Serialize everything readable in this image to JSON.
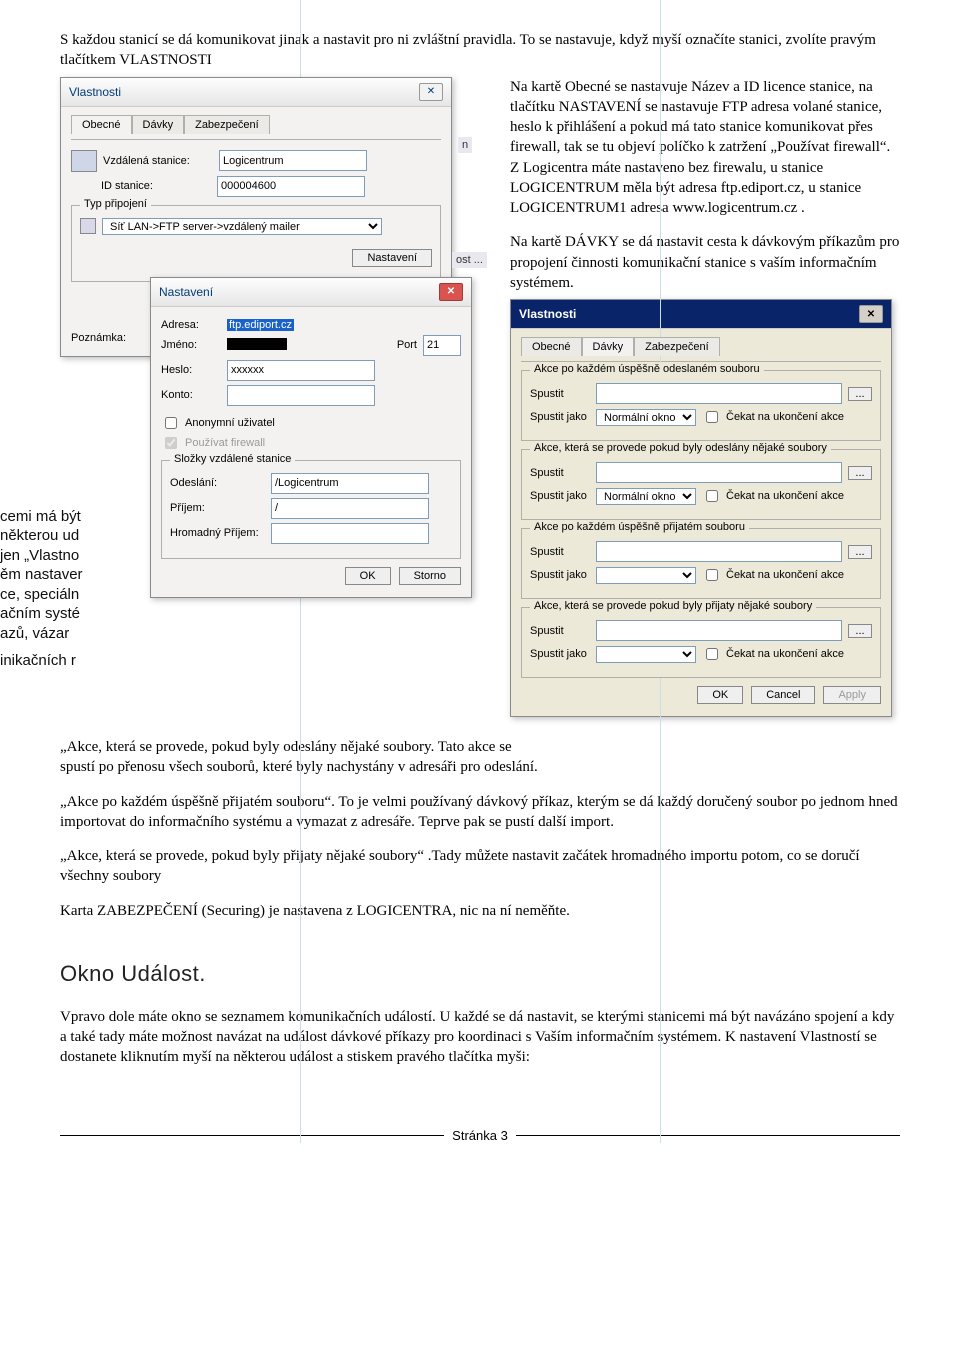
{
  "intro": "S každou stanicí se dá komunikovat jinak a nastavit pro ni zvláštní pravidla. To se nastavuje, když myší označíte stanici, zvolíte pravým tlačítkem VLASTNOSTI",
  "right1": "Na kartě Obecné se nastavuje Název a ID licence stanice, na tlačítku NASTAVENÍ se nastavuje FTP adresa volané stanice, heslo k přihlášení a pokud má tato stanice komunikovat přes firewall, tak se tu objeví políčko k zatržení „Používat firewall“. Z Logicentra máte nastaveno bez firewalu, u stanice LOGICENTRUM měla být adresa ftp.ediport.cz, u stanice LOGICENTRUM1 adresa www.logicentrum.cz .",
  "right2": "Na kartě DÁVKY se dá nastavit cesta k dávkovým příkazům pro propojení činnosti komunikační stanice s vaším informačním systémem.",
  "after1": " „Akce, která se provede, pokud byly odeslány nějaké soubory. Tato akce se spustí po přenosu všech souborů, které byly nachystány v adresáři pro odeslání.",
  "after2": "„Akce po každém úspěšně přijatém souboru“. To je velmi používaný dávkový příkaz, kterým se dá každý doručený soubor po jednom hned importovat do informačního systému a vymazat z adresáře. Teprve pak se pustí další import.",
  "after3": " „Akce, která se provede, pokud byly přijaty nějaké soubory“ .Tady můžete nastavit začátek hromadného importu potom, co se doručí všechny soubory",
  "after4": "Karta ZABEZPEČENÍ (Securing) je nastavena z LOGICENTRA, nic na ní neměňte.",
  "section2_title": "Okno Událost.",
  "section2_body": "Vpravo dole máte okno se seznamem komunikačních událostí. U každé se dá nastavit, se kterými stanicemi má být navázáno spojení a kdy a také tady máte možnost navázat na událost dávkové příkazy pro koordinaci s Vaším informačním systémem. K nastavení Vlastností se dostanete kliknutím myší na některou událost a stiskem pravého tlačítka myši:",
  "footer": "Stránka 3",
  "side_frags": [
    "cemi má být",
    "některou ud",
    "jen „Vlastno",
    "ěm nastaver",
    "ce, speciáln",
    "ačním systé",
    "azů, vázar",
    "inikačních r"
  ],
  "bg_frags": {
    "a": "n",
    "b": "ost ..."
  },
  "vlast": {
    "title": "Vlastnosti",
    "tabs": [
      "Obecné",
      "Dávky",
      "Zabezpečení"
    ],
    "vz_lbl": "Vzdálená stanice:",
    "vz_val": "Logicentrum",
    "id_lbl": "ID stanice:",
    "id_val": "000004600",
    "grp_typ": "Typ připojení",
    "conn": "Síť LAN->FTP server->vzdálený mailer",
    "btn_nast": "Nastavení",
    "pozn": "Poznámka:"
  },
  "nast": {
    "title": "Nastavení",
    "adresa_l": "Adresa:",
    "adresa_v": "ftp.ediport.cz",
    "jmeno_l": "Jméno:",
    "port_l": "Port",
    "port_v": "21",
    "heslo_l": "Heslo:",
    "heslo_v": "xxxxxx",
    "konto_l": "Konto:",
    "chk_anon": "Anonymní uživatel",
    "chk_fw": "Používat firewall",
    "grp_slozky": "Složky vzdálené stanice",
    "odes_l": "Odeslání:",
    "odes_v": "/Logicentrum",
    "prij_l": "Příjem:",
    "prij_v": "/",
    "hrom_l": "Hromadný Příjem:",
    "ok": "OK",
    "storno": "Storno"
  },
  "davky": {
    "title": "Vlastnosti",
    "tabs": [
      "Obecné",
      "Dávky",
      "Zabezpečení"
    ],
    "g1": "Akce po každém úspěšně odeslaném souboru",
    "g2": "Akce, která se provede pokud byly odeslány nějaké soubory",
    "g3": "Akce po každém úspěšně přijatém souboru",
    "g4": "Akce, která se provede pokud byly přijaty nějaké soubory",
    "spustit": "Spustit",
    "spustit_jako": "Spustit jako",
    "norm": "Normální okno",
    "cekat": "Čekat na ukončení akce",
    "ok": "OK",
    "cancel": "Cancel",
    "apply": "Apply"
  }
}
